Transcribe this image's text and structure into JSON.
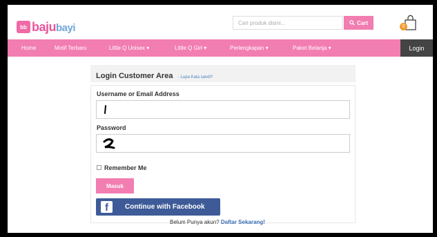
{
  "brand": {
    "logo_box": "bb",
    "name_part1": "baju",
    "name_part2": "bayi"
  },
  "search": {
    "placeholder": "Cari produk disini...",
    "button_label": "Cart"
  },
  "cart": {
    "count": "0"
  },
  "nav": {
    "items": [
      "Home",
      "Motif Terbaru",
      "Little Q Unisex",
      "Little Q Girl",
      "Perlengkapan",
      "Paket Belanja"
    ],
    "dropdown_suffix": "▾",
    "login_label": "Login"
  },
  "login_area": {
    "title": "Login Customer Area",
    "forgot_link": "- Lupa Kata sandi?"
  },
  "form": {
    "username_label": "Username or Email Address",
    "username_value": "1",
    "password_label": "Password",
    "password_value": "2",
    "remember_label": "Remember Me",
    "submit_label": "Masuk",
    "facebook_label": "Continue with Facebook"
  },
  "footer": {
    "prompt": "Belum Punya akun?",
    "signup_link": "Daftar Sekarang!"
  },
  "colors": {
    "accent": "#f27db1",
    "facebook": "#3e5b98",
    "dark": "#444444"
  }
}
